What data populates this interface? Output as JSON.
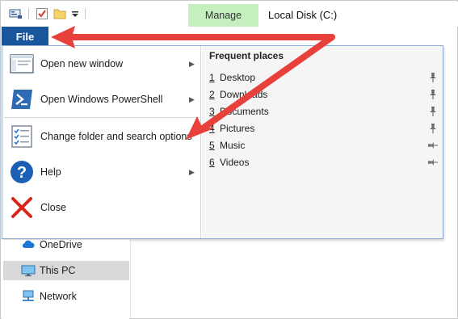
{
  "titlebar": {
    "manage_label": "Manage",
    "window_title": "Local Disk (C:)",
    "qat_icons": [
      "properties-icon",
      "checkmark-icon",
      "new-folder-icon",
      "customize-qat-icon"
    ]
  },
  "file_tab": {
    "label": "File"
  },
  "menu": {
    "items": [
      {
        "label": "Open new window",
        "icon": "new-window-icon",
        "has_submenu": true
      },
      {
        "label": "Open Windows PowerShell",
        "icon": "powershell-icon",
        "has_submenu": true
      },
      {
        "label": "Change folder and search options",
        "icon": "folder-options-icon",
        "has_submenu": false
      },
      {
        "label": "Help",
        "icon": "help-icon",
        "has_submenu": true
      },
      {
        "label": "Close",
        "icon": "close-icon",
        "has_submenu": false
      }
    ],
    "arrow_glyph": "▶"
  },
  "frequent": {
    "heading": "Frequent places",
    "items": [
      {
        "num": "1",
        "label": "Desktop",
        "pinned": true
      },
      {
        "num": "2",
        "label": "Downloads",
        "pinned": true
      },
      {
        "num": "3",
        "label": "Documents",
        "pinned": true
      },
      {
        "num": "4",
        "label": "Pictures",
        "pinned": true
      },
      {
        "num": "5",
        "label": "Music",
        "pinned": false
      },
      {
        "num": "6",
        "label": "Videos",
        "pinned": false
      }
    ]
  },
  "nav": {
    "items": [
      {
        "label": "OneDrive",
        "icon": "cloud-icon",
        "selected": false
      },
      {
        "label": "This PC",
        "icon": "computer-icon",
        "selected": true
      },
      {
        "label": "Network",
        "icon": "network-icon",
        "selected": false
      }
    ]
  },
  "colors": {
    "file_tab": "#19569e",
    "manage_tab": "#c6efc0",
    "annotation_arrow": "#e8403a",
    "selected_nav": "#d9d9d9"
  }
}
